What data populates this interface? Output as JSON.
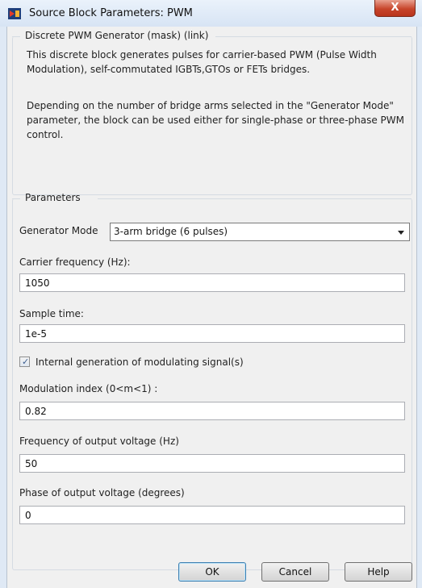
{
  "window": {
    "title": "Source Block Parameters: PWM",
    "close_label": "X"
  },
  "description": {
    "group_title": "Discrete PWM Generator (mask) (link)",
    "line1": "This discrete block generates pulses for carrier-based PWM (Pulse Width",
    "line2": "Modulation), self-commutated IGBTs,GTOs or FETs bridges.",
    "line3": "Depending on the number of bridge arms selected in the \"Generator Mode\"",
    "line4": "parameter, the block can be used either for single-phase or three-phase PWM",
    "line5": "control."
  },
  "parameters": {
    "group_title": "Parameters",
    "generator_mode_label": "Generator Mode",
    "generator_mode_value": "3-arm  bridge (6 pulses)",
    "carrier_frequency_label": "Carrier frequency (Hz):",
    "carrier_frequency_value": "1050",
    "sample_time_label": "Sample time:",
    "sample_time_value": "1e-5",
    "internal_generation_label": "Internal generation of modulating signal(s)",
    "internal_generation_checked": true,
    "modulation_index_label": "Modulation index  (0<m<1) :",
    "modulation_index_value": "0.82",
    "output_frequency_label": "Frequency of output voltage (Hz)",
    "output_frequency_value": "50",
    "output_phase_label": "Phase of output voltage (degrees)",
    "output_phase_value": "0"
  },
  "buttons": {
    "ok": "OK",
    "cancel": "Cancel",
    "help": "Help"
  },
  "colors": {
    "titlebar": "#dfe9f5",
    "dialog_bg": "#f0f0f0",
    "close_button": "#c7452b"
  },
  "icons": {
    "app": "simulink-block-icon",
    "close": "close-icon",
    "dropdown": "chevron-down-icon",
    "check": "checkmark-icon"
  }
}
